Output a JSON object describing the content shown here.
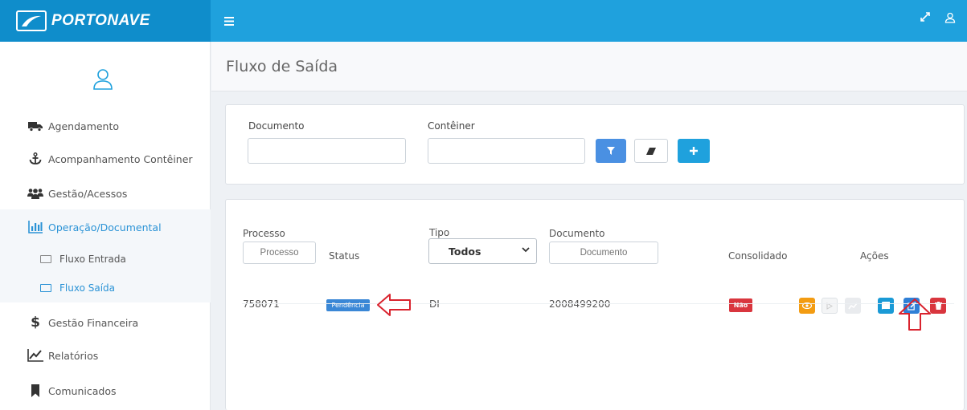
{
  "brand": {
    "name": "PORTONAVE"
  },
  "topbar": {
    "menu_icon": "hamburger-icon",
    "expand_icon": "expand-icon",
    "user_icon": "user-icon"
  },
  "sidebar": {
    "items": [
      {
        "label": "Agendamento",
        "icon": "truck-icon"
      },
      {
        "label": "Acompanhamento Contêiner",
        "icon": "anchor-icon"
      },
      {
        "label": "Gestão/Acessos",
        "icon": "users-icon"
      },
      {
        "label": "Operação/Documental",
        "icon": "bar-chart-icon",
        "active": true
      },
      {
        "label": "Gestão Financeira",
        "icon": "dollar-icon"
      },
      {
        "label": "Relatórios",
        "icon": "line-chart-icon"
      },
      {
        "label": "Comunicados",
        "icon": "bookmark-icon"
      }
    ],
    "subitems": [
      {
        "label": "Fluxo Entrada",
        "icon": "monitor-icon"
      },
      {
        "label": "Fluxo Saída",
        "icon": "monitor-icon",
        "active": true
      }
    ]
  },
  "page": {
    "title": "Fluxo de Saída"
  },
  "filters": {
    "documento_label": "Documento",
    "conteiner_label": "Contêiner",
    "documento_value": "",
    "conteiner_value": ""
  },
  "table": {
    "headers": {
      "processo": "Processo",
      "status": "Status",
      "tipo": "Tipo",
      "documento": "Documento",
      "consolidado": "Consolidado",
      "acoes": "Ações"
    },
    "filters": {
      "processo_placeholder": "Processo",
      "tipo_selected": "Todos",
      "documento_placeholder": "Documento"
    },
    "rows": [
      {
        "processo": "758071",
        "status": "Pendência",
        "tipo": "DI",
        "documento": "2008499200",
        "consolidado": "Não"
      }
    ]
  },
  "colors": {
    "topbar": "#1fa1dd",
    "brand_bg": "#0f8dcb",
    "primary": "#4a90e2",
    "accent_blue": "#2b93d6",
    "status_badge": "#3a87d6",
    "consolidado_badge": "#d9363e",
    "action_view": "#f39c12",
    "action_book": "#1a9ad6",
    "action_edit": "#2f7fd6",
    "action_delete": "#d9363e",
    "annotation_arrow": "#d9232e"
  }
}
